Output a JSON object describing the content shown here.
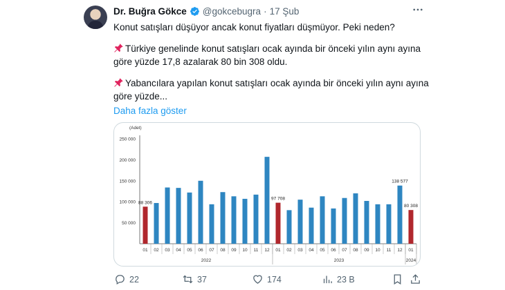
{
  "author": {
    "name": "Dr. Buğra Gökce",
    "handle": "@gokcebugra",
    "separator": "·",
    "date": "17 Şub"
  },
  "tweet": {
    "line1": "Konut satışları düşüyor ancak konut fiyatları düşmüyor. Peki neden?",
    "para2_line1": "Türkiye genelinde konut satışları ocak ayında bir önceki yılın aynı ayına",
    "para2_line2": "göre yüzde 17,8 azalarak 80 bin 308 oldu.",
    "para3_line1": "Yabancılara yapılan konut satışları ocak ayında bir önceki yılın aynı ayına",
    "para3_line2": "göre yüzde...",
    "show_more": "Daha fazla göster"
  },
  "actions": {
    "replies": "22",
    "retweets": "37",
    "likes": "174",
    "views": "23 B"
  },
  "icons": [
    "more-icon",
    "verified-icon",
    "pin-icon",
    "reply-icon",
    "retweet-icon",
    "like-icon",
    "views-icon",
    "bookmark-icon",
    "share-icon"
  ],
  "colors": {
    "accent": "#1d9bf0",
    "bar_blue": "#2e86c1",
    "bar_red": "#b0272d"
  },
  "chart_data": {
    "type": "bar",
    "unit_label": "(Adet)",
    "ylim": [
      0,
      250000
    ],
    "yticks": [
      50000,
      100000,
      150000,
      200000,
      250000
    ],
    "ytick_labels": [
      "50 000",
      "100 000",
      "150 000",
      "200 000",
      "250 000"
    ],
    "categories": [
      "01",
      "02",
      "03",
      "04",
      "05",
      "06",
      "07",
      "08",
      "09",
      "10",
      "11",
      "12",
      "01",
      "02",
      "03",
      "04",
      "05",
      "06",
      "07",
      "08",
      "09",
      "10",
      "11",
      "12",
      "01"
    ],
    "year_labels": [
      "2022",
      "2023",
      "2024"
    ],
    "values": [
      88306,
      97000,
      134000,
      133000,
      122000,
      150000,
      94000,
      123000,
      113000,
      107000,
      117000,
      207000,
      97708,
      80000,
      105000,
      86000,
      113000,
      84000,
      109000,
      120000,
      102000,
      94000,
      94000,
      138577,
      80308
    ],
    "highlight_indices": [
      0,
      12,
      24
    ],
    "data_labels": [
      {
        "index": 0,
        "text": "88 306"
      },
      {
        "index": 12,
        "text": "97 708"
      },
      {
        "index": 23,
        "text": "138 577"
      },
      {
        "index": 24,
        "text": "80 308"
      }
    ]
  }
}
